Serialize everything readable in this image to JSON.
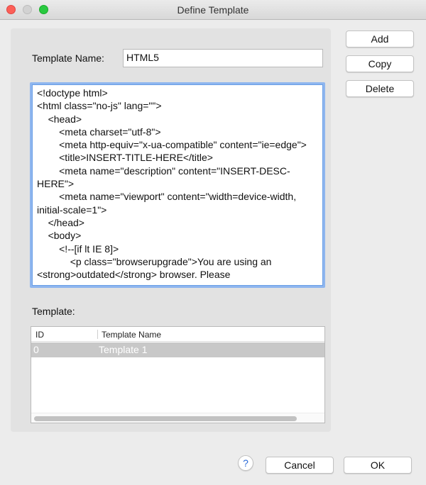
{
  "window": {
    "title": "Define Template"
  },
  "form": {
    "template_name_label": "Template Name:",
    "template_name_value": "HTML5",
    "template_list_label": "Template:"
  },
  "editor": {
    "code": "<!doctype html>\n<html class=\"no-js\" lang=\"\">\n    <head>\n        <meta charset=\"utf-8\">\n        <meta http-equiv=\"x-ua-compatible\" content=\"ie=edge\">\n        <title>INSERT-TITLE-HERE</title>\n        <meta name=\"description\" content=\"INSERT-DESC-HERE\">\n        <meta name=\"viewport\" content=\"width=device-width, initial-scale=1\">\n    </head>\n    <body>\n        <!--[if lt IE 8]>\n            <p class=\"browserupgrade\">You are using an <strong>outdated</strong> browser. Please"
  },
  "table": {
    "columns": [
      "ID",
      "Template Name"
    ],
    "rows": [
      {
        "id": "0",
        "name": "Template  1"
      }
    ]
  },
  "side_buttons": {
    "add": "Add",
    "copy": "Copy",
    "delete": "Delete"
  },
  "footer": {
    "help": "?",
    "cancel": "Cancel",
    "ok": "OK"
  },
  "colors": {
    "selection_row": "#c8c8c8",
    "focus_ring": "#8fb6ef",
    "close": "#fc5f57",
    "maximize": "#29c940"
  }
}
